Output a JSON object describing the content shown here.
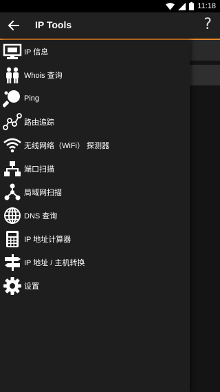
{
  "status": {
    "time": "11:18"
  },
  "appbar": {
    "title": "IP Tools",
    "help": "?"
  },
  "menu": [
    {
      "label": "IP 信息",
      "icon": "monitor-icon"
    },
    {
      "label": "Whois 查询",
      "icon": "people-icon"
    },
    {
      "label": "Ping",
      "icon": "ping-pong-icon"
    },
    {
      "label": "路由追踪",
      "icon": "route-trace-icon"
    },
    {
      "label": "无线网络（WiFi） 探测器",
      "icon": "wifi-icon"
    },
    {
      "label": "端口扫描",
      "icon": "port-network-icon"
    },
    {
      "label": "局域网扫描",
      "icon": "lan-icon"
    },
    {
      "label": "DNS 查询",
      "icon": "globe-icon"
    },
    {
      "label": "IP 地址计算器",
      "icon": "calculator-icon"
    },
    {
      "label": "IP 地址 / 主机转换",
      "icon": "signpost-icon"
    },
    {
      "label": "设置",
      "icon": "gear-icon"
    }
  ]
}
